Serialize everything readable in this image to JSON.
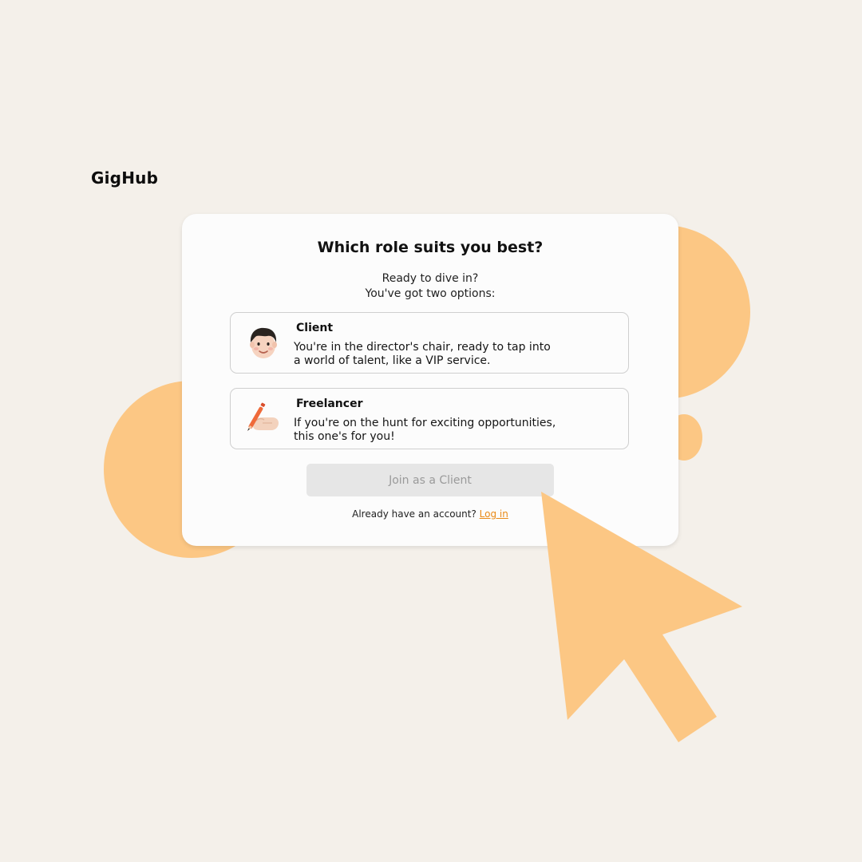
{
  "brand": {
    "name": "GigHub",
    "accent_color": "#fcc784",
    "link_color": "#e98a16"
  },
  "card": {
    "title": "Which role suits you best?",
    "subtitle_line1": "Ready to dive in?",
    "subtitle_line2": "You've got two options:"
  },
  "options": [
    {
      "title": "Client",
      "description_line1": "You're in the director's chair, ready to tap into",
      "description_line2": "a world of talent, like a VIP service.",
      "icon": "person-avatar-icon"
    },
    {
      "title": "Freelancer",
      "description_line1": "If you're on the hunt for exciting opportunities,",
      "description_line2": "this one's for you!",
      "icon": "writing-hand-icon"
    }
  ],
  "join_button": {
    "label": "Join as a Client",
    "state": "disabled"
  },
  "login": {
    "prompt": "Already have an account?",
    "link_label": "Log in"
  },
  "cursor": {
    "icon": "mouse-pointer-arrow-icon"
  }
}
